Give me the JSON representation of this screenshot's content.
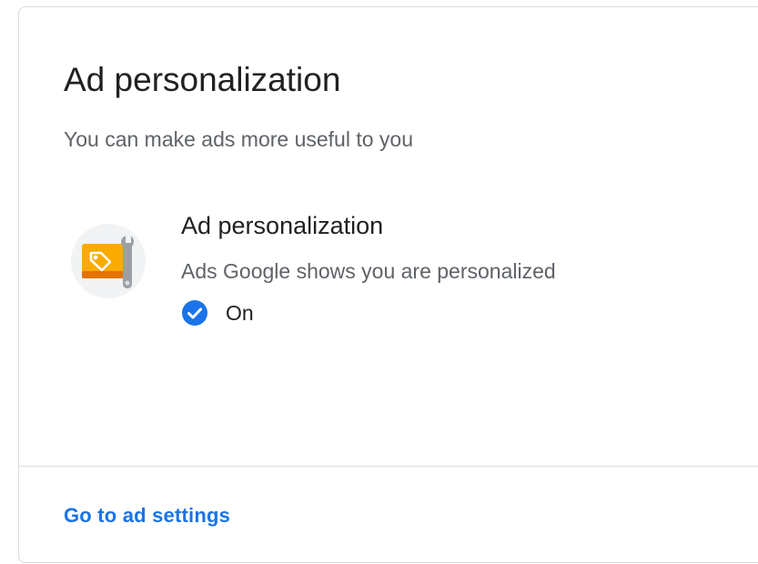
{
  "card": {
    "title": "Ad personalization",
    "subtitle": "You can make ads more useful to you"
  },
  "setting": {
    "icon": "ad-settings-tag-wrench-icon",
    "name": "Ad personalization",
    "description": "Ads Google shows you are personalized",
    "status_icon": "check-circle-icon",
    "status_text": "On"
  },
  "footer": {
    "link_label": "Go to ad settings"
  },
  "colors": {
    "accent": "#1a73e8",
    "title_text": "#202124",
    "secondary_text": "#5f6368",
    "border": "#dadce0",
    "tag_orange": "#f9ab00",
    "icon_bg": "#f1f3f4"
  }
}
